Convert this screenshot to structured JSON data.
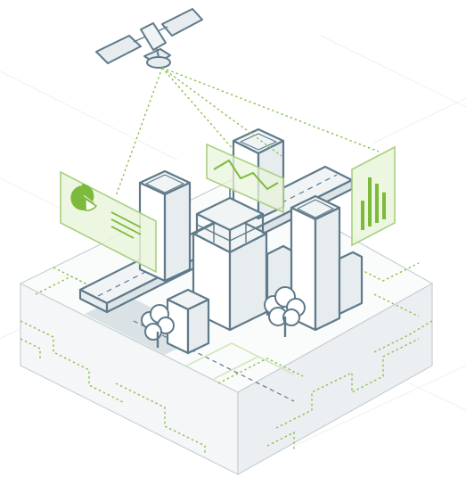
{
  "illustration": {
    "palette": {
      "stroke": "#5f7a8a",
      "building_front": "#ffffff",
      "building_side": "#e7ecef",
      "building_top": "#f1f4f5",
      "shadow": "#cdd6dc",
      "accent_green": "#7cba3b",
      "panel_green": "#e9f4dc",
      "grid_dash": "#8cc152",
      "base_top": "#fafbfb",
      "base_front": "#f4f6f7",
      "base_side": "#eceff1"
    },
    "icons": {
      "satellite": "satellite-icon",
      "pie_panel": "pie-chart-icon",
      "line_panel": "line-chart-icon",
      "bar_panel": "bar-chart-icon",
      "trees": "tree-icon"
    },
    "bar_panel_values": [
      0.6,
      1.0,
      0.8,
      0.55
    ]
  }
}
